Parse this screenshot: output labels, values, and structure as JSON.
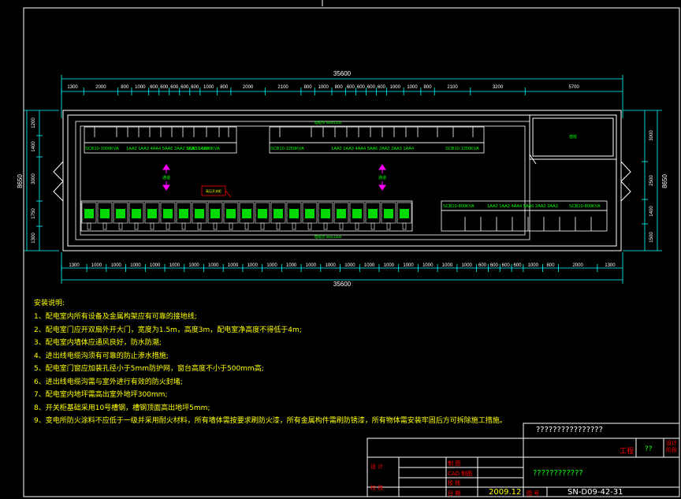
{
  "top_total_dim": "35600",
  "bottom_total_dim": "35600",
  "top_dims": [
    "1300",
    "2000",
    "800",
    "1000",
    "600",
    "600",
    "600",
    "600",
    "600",
    "1000",
    "800",
    "2000",
    "2100",
    "800",
    "1000",
    "800",
    "600",
    "600",
    "600",
    "600",
    "1000",
    "1000",
    "800",
    "2100",
    "3200",
    "5700"
  ],
  "bottom_dims": [
    "1300",
    "1000",
    "1000",
    "1000",
    "1000",
    "1000",
    "1000",
    "1000",
    "1000",
    "1000",
    "1000",
    "1000",
    "1000",
    "1000",
    "1000",
    "1000",
    "1000",
    "1000",
    "1000",
    "1000",
    "1000",
    "600",
    "600",
    "600",
    "600",
    "1000",
    "800",
    "2000",
    "1300"
  ],
  "left_dims": [
    "1200",
    "1400",
    "3000",
    "1750",
    "1300"
  ],
  "left_total": "8650",
  "right_dims": [
    "3000",
    "2500",
    "1400",
    "1500"
  ],
  "right_total": "8650",
  "room_top_label": "电缆沟 800x1200",
  "room_bottom_label": "电缆沟 800x1200",
  "transformer_labels": [
    "SCB10-1000KVA",
    "SCB10-1000KVA",
    "SCB10-1250KVA",
    "SCB10-1250KVA",
    "SCB10-800KVA",
    "SCB10-800KVA"
  ],
  "top_row_text_left": "1AA2 1AA3 4AA4 5AA6 2AA2 2AA3 1AA4",
  "top_row_text_right": "1AA2 1AA3 4AA4 5AA6 2AA2 2AA3 1AA4",
  "right_row_text": "1AA2 1AA3 4AA4 5AA6 2AA2 2AA3",
  "side_room_label": "值班",
  "arrow_label": "通道",
  "hv_label": "高压开关柜",
  "notes_title": "安装说明:",
  "notes": [
    "1、配电室内所有设备及金属构架应有可靠的接地线;",
    "2、配电室门应开双扇外开大门，宽度为1.5m，高度3m，配电室净高度不得低于4m;",
    "3、配电室内墙体应通风良好，防水防潮;",
    "4、进出线电缆沟须有可靠的防止渗水措施;",
    "5、配电室门窗应加装孔径小于5mm防护网，窗台高度不小于500mm高;",
    "6、进出线电缆沟需与室外进行有效的防火封堵;",
    "7、配电室内地坪需高出室外地坪300mm;",
    "8、开关柜基础采用10号槽钢，槽钢顶面高出地坪5mm;",
    "9、变电所防火涂料不应低于一级并采用耐火材料，所有墙体需按要求刷防火漆，所有金属构件需刷防锈漆，所有物体需安装牢固后方可拆除施工措施。"
  ],
  "titleblock": {
    "project_title": "????????????????",
    "drawing_title": "????????????",
    "stage_label": "工程",
    "stage_value": "??",
    "design_label": "设计阶段",
    "drawn_label": "制 图",
    "check_label": "校 核",
    "review_label": "审 核",
    "approve_label": "批 准",
    "date_label": "日 期",
    "cad_label": "CAD 制图",
    "left_labels": [
      "设 计",
      "校 核"
    ],
    "scale_label": "图 号",
    "date_value": "2009.12",
    "drawing_no": "SN-D09-42-31"
  },
  "colors": {
    "bg": "#000000",
    "dim": "#ffffff",
    "equipment": "#00ff00",
    "arrow": "#ff00ff",
    "text": "#ffff00",
    "ext": "#00ffff",
    "accent": "#ff0000"
  }
}
